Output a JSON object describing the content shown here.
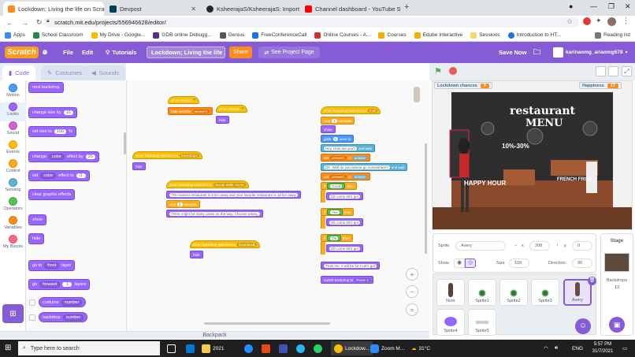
{
  "browser": {
    "tabs": [
      {
        "label": "Lockdown; Living the life on Scratch",
        "color": "#ff8c1a"
      },
      {
        "label": "Devpost",
        "color": "#003e54"
      },
      {
        "label": "KsheerajaS/KsheerajaS: Import a",
        "color": "#24292e"
      },
      {
        "label": "Channel dashboard - YouTube St",
        "color": "#ff0000"
      }
    ],
    "url": "scratch.mit.edu/projects/556946628/editor/",
    "bookmarks": [
      "Apps",
      "School Classroom",
      "My Drive - Google...",
      "GDB online Debugg...",
      "Genius",
      "FreeConferenceCall",
      "Online Courses - A...",
      "Courses",
      "Edube Interactive",
      "Sessions",
      "Introduction to HT..."
    ],
    "reading_list": "Reading list"
  },
  "menu": {
    "logo": "Scratch",
    "file": "File",
    "edit": "Edit",
    "tutorials": "Tutorials",
    "project_title": "Lockdown; Living the life",
    "share": "Share",
    "see_project": "See Project Page",
    "save_now": "Save Now",
    "username": "karinaomg_ariaomg678"
  },
  "editor_tabs": {
    "code": "Code",
    "costumes": "Costumes",
    "sounds": "Sounds"
  },
  "categories": [
    {
      "label": "Motion",
      "color": "#4c97ff"
    },
    {
      "label": "Looks",
      "color": "#9966ff"
    },
    {
      "label": "Sound",
      "color": "#cf63cf"
    },
    {
      "label": "Events",
      "color": "#ffbf00"
    },
    {
      "label": "Control",
      "color": "#ffab19"
    },
    {
      "label": "Sensing",
      "color": "#5cb1d6"
    },
    {
      "label": "Operators",
      "color": "#59c059"
    },
    {
      "label": "Variables",
      "color": "#ff8c1a"
    },
    {
      "label": "My Blocks",
      "color": "#ff6680"
    }
  ],
  "palette": {
    "next_backdrop": "next backdrop",
    "change_size": "change size by",
    "change_size_val": "10",
    "set_size": "set size to",
    "set_size_val": "100",
    "pct": "%",
    "change_effect": "change",
    "effect_color": "color",
    "effect_by": "effect by",
    "effect_by_val": "25",
    "set_effect": "set",
    "effect_to": "effect to",
    "effect_to_val": "0",
    "clear_effects": "clear graphic effects",
    "show": "show",
    "hide": "hide",
    "goto": "go to",
    "front": "front",
    "layer": "layer",
    "go": "go",
    "forward": "forward",
    "layers_val": "1",
    "layers": "layers",
    "costume": "costume",
    "number": "number",
    "backdrop": "backdrop"
  },
  "workspace": {
    "s1_hat": "when clicked",
    "s1_b1": "hide variable",
    "s1_var": "answer1",
    "s2_hat": "when clicked",
    "s2_b1": "hide",
    "s3_hat": "when backdrop switches to",
    "s3_val": "backdrop4",
    "s3_b1": "hide",
    "s4_hat": "when backdrop switches to",
    "s4_val": "Social Walk Home",
    "s4_say1": "The nearest restaurant is 5 km away and your favorite restaurant is 10 km away",
    "s4_wait": "wait",
    "s4_wait_val": "3",
    "s4_secs": "seconds",
    "s4_say2": "There might be many cases on the way. Choose wisely.",
    "s5_hat": "when backdrop switches to",
    "s5_val": "Boardwalk",
    "s5_b1": "hide",
    "s6_hat": "when backdrop switches to",
    "s6_val": "mall",
    "s6_wait": "wait",
    "s6_wait_val": "1",
    "s6_secs": "seconds",
    "s6_show": "show",
    "s6_glide": "glide",
    "s6_glide_val": "1",
    "s6_glide_to": "secs to",
    "s6_ask1": "Hey, How are you?",
    "s6_ask_wait": "and wait",
    "s6_set": "set",
    "s6_setvar": "answer1",
    "s6_to": "to",
    "s6_answer": "answer",
    "s6_ask2": "Oh. Well do you wanna go somewhere?",
    "s6_if": "if",
    "s6_then": "then",
    "s6_cmp1": "Good",
    "s6_say_a": "Oh come let's go!",
    "s6_cmp2": "Yes",
    "s6_say_b": "Oh come let's go!",
    "s6_cmp3": "Ok",
    "s6_say_c": "Oh come let's go!",
    "s6_say_d": "Trust me, it will be fun! Let's go!",
    "s6_switch": "switch backdrop to",
    "s6_switch_val": "Room 1"
  },
  "backpack": "Backpack",
  "stage": {
    "monitor1_label": "Lockdown chances",
    "monitor1_val": "0",
    "monitor2_label": "Happiness",
    "monitor2_val": "17",
    "sign1": "restaurant",
    "sign2": "MENU",
    "sign3": "HAPPY HOUR",
    "sign4": "10%-30%",
    "sign5": "FRENCH FRIES"
  },
  "sprite_info": {
    "sprite_label": "Sprite",
    "sprite_name": "Avery",
    "x_label": "x",
    "x_val": "208",
    "y_label": "y",
    "y_val": "0",
    "show_label": "Show",
    "size_label": "Size",
    "size_val": "100",
    "direction_label": "Direction",
    "direction_val": "90"
  },
  "sprites": [
    {
      "name": "Noor"
    },
    {
      "name": "Sprite1"
    },
    {
      "name": "Sprite2"
    },
    {
      "name": "Sprite3"
    },
    {
      "name": "Avery"
    },
    {
      "name": "Sprite4"
    },
    {
      "name": "Sprite5"
    }
  ],
  "stage_panel": {
    "title": "Stage",
    "backdrops_label": "Backdrops",
    "backdrops_count": "13"
  },
  "taskbar": {
    "search": "Type here to search",
    "items": [
      "2021",
      "Lockdow...",
      "Zoom M..."
    ],
    "weather": "31°C",
    "lang": "ENG",
    "time": "5:57 PM",
    "date": "31/7/2021"
  }
}
